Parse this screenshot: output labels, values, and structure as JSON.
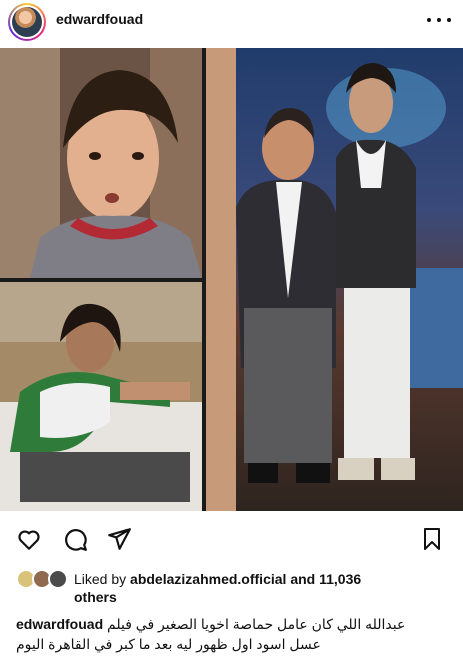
{
  "header": {
    "username": "edwardfouad"
  },
  "post": {
    "panels": [
      {
        "name": "boy-portrait"
      },
      {
        "name": "man-in-bed"
      },
      {
        "name": "two-men-standing"
      }
    ]
  },
  "actions": {
    "icons": [
      "heart-icon",
      "comment-icon",
      "share-icon",
      "bookmark-icon"
    ]
  },
  "likes": {
    "prefix": "Liked by",
    "user": "abdelazizahmed.official",
    "suffix": "and 11,036",
    "others": "others"
  },
  "caption": {
    "username": "edwardfouad",
    "line1": "عبدالله اللي كان عامل حماصة اخويا الصغير في فيلم",
    "line2": "عسل اسود اول ظهور ليه بعد ما كبر في القاهرة اليوم"
  },
  "colors": {
    "text": "#111111",
    "background": "#ffffff"
  }
}
